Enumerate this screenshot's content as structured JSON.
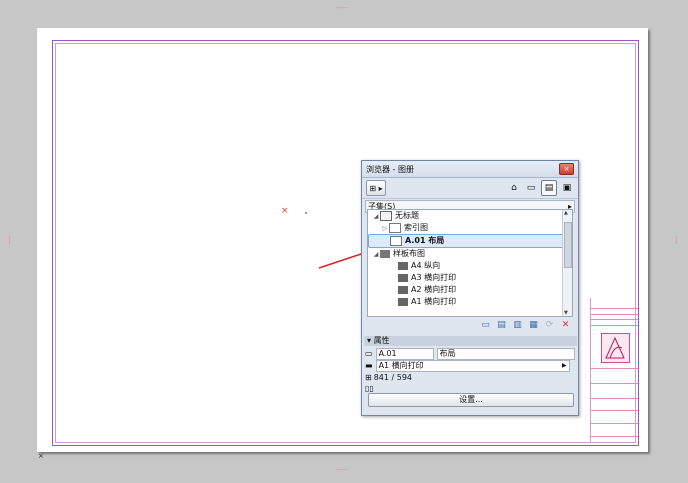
{
  "canvas": {
    "top_mark": "-----",
    "bottom_mark": "-----",
    "left_mark": "|",
    "right_mark": "|",
    "corner_mark": "×"
  },
  "drawing": {
    "center_marker": "×"
  },
  "browser": {
    "title": "浏览器 - 图册",
    "close_label": "×",
    "toolbar": {
      "tree_button_label": "⊞ ▸",
      "mode_icons": [
        "project-map-icon",
        "view-map-icon",
        "layout-book-icon",
        "publisher-icon"
      ]
    },
    "subset": {
      "label": "子集(S)",
      "arrow": "▸"
    },
    "tree": {
      "items": [
        {
          "label": "无标题",
          "level": 0,
          "expander": "◢",
          "icon": "book-icon",
          "selected": false
        },
        {
          "label": "索引图",
          "level": 1,
          "expander": "▷",
          "icon": "white-page-icon",
          "selected": false
        },
        {
          "label": "A.01 布局",
          "level": 1,
          "expander": "",
          "icon": "white-page-icon",
          "selected": true
        },
        {
          "label": "样板布图",
          "level": 0,
          "expander": "◢",
          "icon": "folder-icon",
          "selected": false
        },
        {
          "label": "A4 纵向",
          "level": 2,
          "expander": "",
          "icon": "sheet-icon",
          "selected": false
        },
        {
          "label": "A3 横向打印",
          "level": 2,
          "expander": "",
          "icon": "sheet-icon",
          "selected": false
        },
        {
          "label": "A2 横向打印",
          "level": 2,
          "expander": "",
          "icon": "sheet-icon",
          "selected": false
        },
        {
          "label": "A1 横向打印",
          "level": 2,
          "expander": "",
          "icon": "sheet-icon",
          "selected": false
        }
      ]
    },
    "actions": [
      "new-layout-icon",
      "new-subset-icon",
      "new-master-icon",
      "copy-icon",
      "refresh-icon",
      "delete-icon"
    ],
    "properties": {
      "header": "属性",
      "id_value": "A.01",
      "name_value": "布局",
      "master_value": "A1 横向打印",
      "size_value": "841 / 594",
      "settings_label": "设置..."
    }
  },
  "colors": {
    "frame": "#9a55c8",
    "selection": "#dceaf9",
    "arrow": "#e02020",
    "delete": "#e0302b"
  }
}
